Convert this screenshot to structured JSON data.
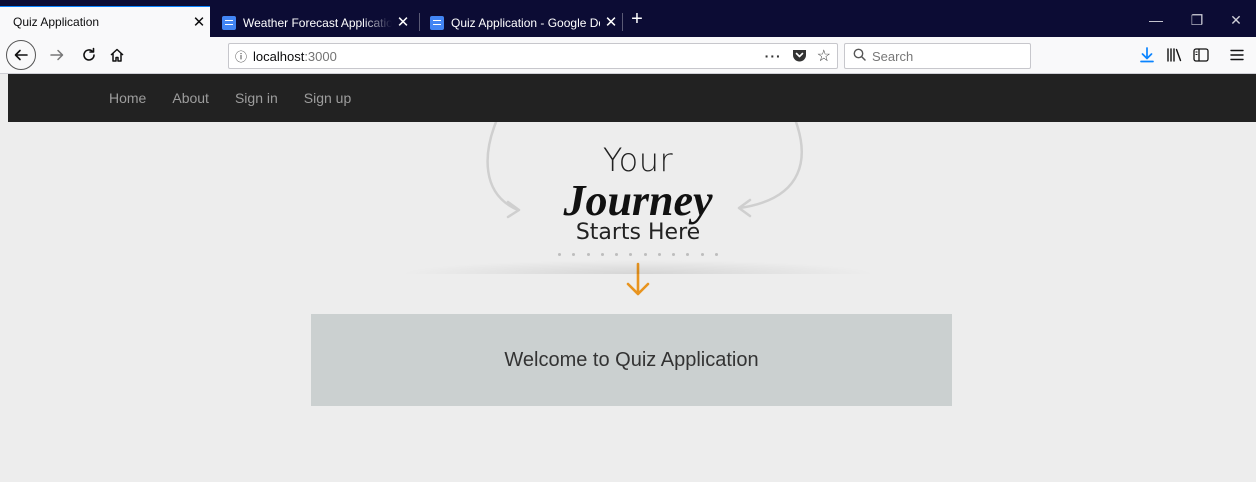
{
  "browser": {
    "tabs": [
      {
        "title": "Quiz Application",
        "active": true
      },
      {
        "title": "Weather Forecast Application -",
        "active": false
      },
      {
        "title": "Quiz Application - Google Docs",
        "active": false
      }
    ],
    "tab_close_glyph": "✕",
    "new_tab_glyph": "+",
    "window_controls": {
      "minimize": "—",
      "restore": "❐",
      "close": "✕"
    },
    "address": {
      "host": "localhost",
      "port": ":3000"
    },
    "search": {
      "placeholder": "Search"
    },
    "icons": [
      "back-icon",
      "forward-icon",
      "reload-icon",
      "home-icon",
      "info-icon",
      "page-actions-icon",
      "pocket-icon",
      "bookmark-star-icon",
      "search-icon",
      "download-icon",
      "library-icon",
      "sidebar-icon",
      "menu-icon"
    ]
  },
  "app": {
    "nav": [
      {
        "label": "Home"
      },
      {
        "label": "About"
      },
      {
        "label": "Sign in"
      },
      {
        "label": "Sign up"
      }
    ],
    "hero": {
      "line1": "Your",
      "line2": "Journey",
      "line3": "Starts Here",
      "arrow_color": "#e8941f"
    },
    "welcome": "Welcome to Quiz Application",
    "colors": {
      "navbar_bg": "#222222",
      "nav_link": "#9d9d9d",
      "page_bg": "#ededed",
      "welcome_bg": "#cbd0d0",
      "tabstrip_bg": "#0c0c34"
    }
  }
}
